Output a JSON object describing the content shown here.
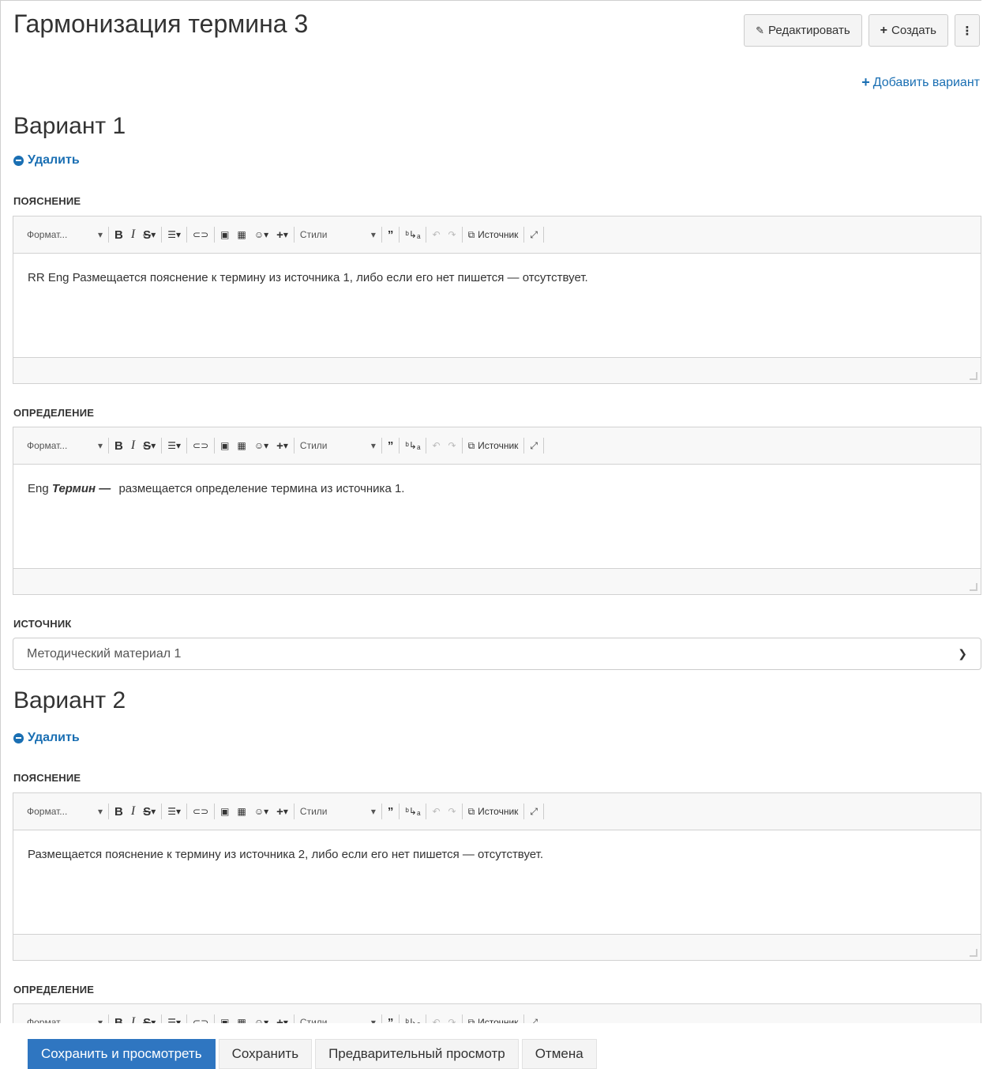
{
  "page": {
    "title": "Гармонизация термина 3",
    "actions": {
      "edit": "Редактировать",
      "create": "Создать",
      "more": "⋮"
    },
    "add_variant": "Добавить вариант"
  },
  "toolbar": {
    "format": "Формат...",
    "bold": "B",
    "italic": "I",
    "strike": "S",
    "styles": "Стили",
    "source": "Источник"
  },
  "variants": [
    {
      "title": "Вариант 1",
      "delete": "Удалить",
      "explanation_label": "ПОЯСНЕНИЕ",
      "explanation_text": "RR Eng Размещается пояснение к термину из источника 1, либо если его нет пишется — отсутствует.",
      "definition_label": "ОПРЕДЕЛЕНИЕ",
      "definition_prefix": "Eng",
      "definition_term": "Термин —",
      "definition_text": "размещается определение термина из источника 1.",
      "source_label": "ИСТОЧНИК",
      "source_value": "Методический материал 1"
    },
    {
      "title": "Вариант 2",
      "delete": "Удалить",
      "explanation_label": "ПОЯСНЕНИЕ",
      "explanation_text": "Размещается пояснение к термину из источника 2, либо если его нет пишется — отсутствует.",
      "definition_label": "ОПРЕДЕЛЕНИЕ"
    }
  ],
  "bottom": {
    "save_view": "Сохранить и просмотреть",
    "save": "Сохранить",
    "preview": "Предварительный просмотр",
    "cancel": "Отмена"
  }
}
